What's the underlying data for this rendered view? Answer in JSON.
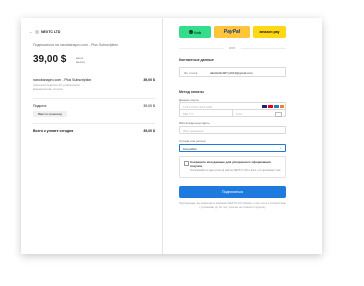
{
  "merchant": {
    "name": "NEXTC LTD"
  },
  "summary": {
    "subscribe_text": "Подписаться на nanobanapro.com - Plus Subscription",
    "price": "39,00 $",
    "period": "раз в месяц",
    "line_item_name": "nanobanapro.com - Plus Subscription",
    "line_item_desc": "Advanced features for professional",
    "line_item_note": "Ежемесячная оплата",
    "line_item_price": "39,00 $",
    "subtotal_label": "Подытог",
    "subtotal_value": "39,00 $",
    "promo_button": "Ввести промокод",
    "total_label": "Всего к уплате сегодня",
    "total_value": "39,00 $"
  },
  "express": {
    "link_label": "link",
    "paypal_label": "PayPal",
    "amazonpay_label": "amazon pay",
    "or_label": "ИЛИ",
    "colors": {
      "link": "#33dd8a",
      "paypal": "#ffc439",
      "amazonpay": "#ffd814"
    }
  },
  "contact": {
    "section_title": "Контактные данные",
    "email_label": "Эл. почта",
    "email_value": "tabdisthi1907.j2013@gmail.com"
  },
  "payment": {
    "section_title": "Метод оплаты",
    "card_info_label": "Данные карты",
    "card_number_placeholder": "1234 1234 1234 1234",
    "expiry_placeholder": "ММ / ГГ",
    "cvc_placeholder": "CVC",
    "cardholder_label": "Имя владельца карты",
    "cardholder_placeholder": "Имя, фамилия",
    "country_label": "Страна или регион",
    "country_value": "Колумбия",
    "accent": "#1f7ae0"
  },
  "save_info": {
    "title": "Сохраните мои данные для ускоренного оформления покупок.",
    "desc": "Оплачивайте в один клик на сайтах NEXTC LTD и всех, кто принимает Link."
  },
  "submit": {
    "label": "Подписаться"
  },
  "footer": {
    "text": "Подтверждая, вы разрешаете компании NEXTC LTD взимать с вас плату в соответствии с условиями до тех пор, пока вы не отмените подписку."
  }
}
